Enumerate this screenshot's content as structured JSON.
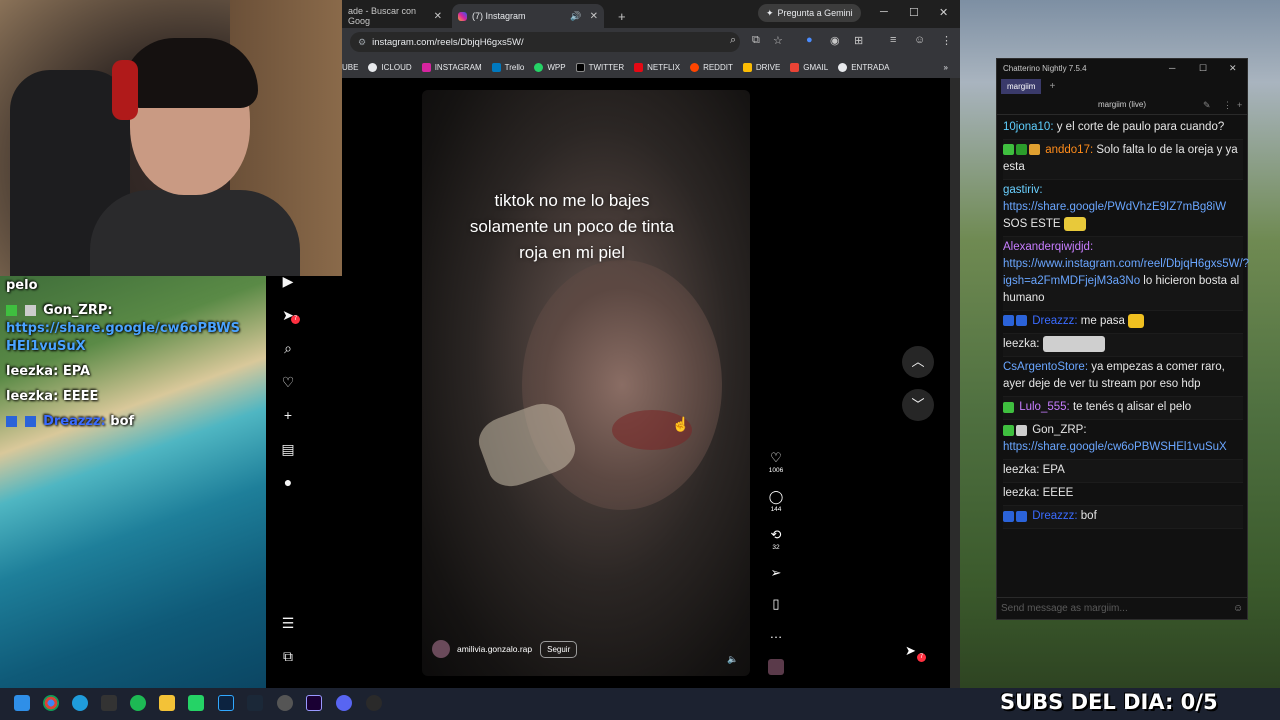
{
  "browser": {
    "tabs": [
      {
        "label": "ade - Buscar con Goog",
        "active": false
      },
      {
        "label": "(7) Instagram",
        "active": true
      }
    ],
    "gemini_label": "Pregunta a Gemini",
    "url": "instagram.com/reels/DbjqH6gxs5W/",
    "bookmarks": [
      "UBE",
      "ICLOUD",
      "INSTAGRAM",
      "Trello",
      "WPP",
      "TWITTER",
      "NETFLIX",
      "REDDIT",
      "DRIVE",
      "GMAIL",
      "ENTRADA"
    ]
  },
  "instagram": {
    "nav_badge": "7",
    "caption_lines": [
      "tiktok no me lo bajes",
      "solamente un poco de tinta",
      "roja en mi piel"
    ],
    "username": "amilivia.gonzalo.rap",
    "follow_label": "Seguir",
    "likes": "1006",
    "comments": "144",
    "reposts": "32",
    "dm_badge": "7"
  },
  "overlay_chat": {
    "lines": [
      {
        "text": "pelo"
      },
      {
        "user": "Gon_ZRP:",
        "text": ""
      },
      {
        "link": "https://share.google/cw6oPBWS HEl1vuSuX"
      },
      {
        "user": "leezka:",
        "text": "EPA"
      },
      {
        "user": "leezka:",
        "text": "EEEE"
      },
      {
        "user": "Dreazzz:",
        "text": "bof"
      }
    ]
  },
  "chatterino": {
    "title": "Chatterino Nightly 7.5.4",
    "tab": "margiim",
    "channel_header": "margiim (live)",
    "messages": [
      {
        "user": "10jona10:",
        "user_color": "#5fd0ff",
        "text": "y el corte de paulo para cuando?"
      },
      {
        "user": "anddo17:",
        "user_color": "#ff8c1a",
        "text": "Solo falta lo de la oreja y ya esta"
      },
      {
        "user": "gastiriv:",
        "user_color": "#6ad0ff",
        "link": "https://share.google/PWdVhzE9IZ7mBg8iW",
        "text": "SOS ESTE"
      },
      {
        "user": "Alexanderqiwjdjd:",
        "user_color": "#c77dff",
        "link": "https://www.instagram.com/reel/DbjqH6gxs5W/?igsh=a2FmMDFjejM3a3No",
        "text": "lo hicieron bosta al humano"
      },
      {
        "user": "Dreazzz:",
        "user_color": "#3a6bff",
        "text": "me pasa"
      },
      {
        "user": "leezka:",
        "user_color": "#ffffff",
        "text": ""
      },
      {
        "user": "CsArgentoStore:",
        "user_color": "#6aa6ff",
        "text": "ya empezas a comer raro, ayer deje de ver tu stream por eso hdp"
      },
      {
        "user": "Lulo_555:",
        "user_color": "#c77dff",
        "text": "te tenés q alisar el pelo"
      },
      {
        "user": "Gon_ZRP:",
        "user_color": "#ffffff",
        "link": "https://share.google/cw6oPBWSHEl1vuSuX",
        "text": ""
      },
      {
        "user": "leezka:",
        "user_color": "#ffffff",
        "text": "EPA"
      },
      {
        "user": "leezka:",
        "user_color": "#ffffff",
        "text": "EEEE"
      },
      {
        "user": "Dreazzz:",
        "user_color": "#3a6bff",
        "text": "bof"
      }
    ],
    "input_placeholder": "Send message as margiim..."
  },
  "overlay_subs": "SUBS DEL DIA: 0/5"
}
